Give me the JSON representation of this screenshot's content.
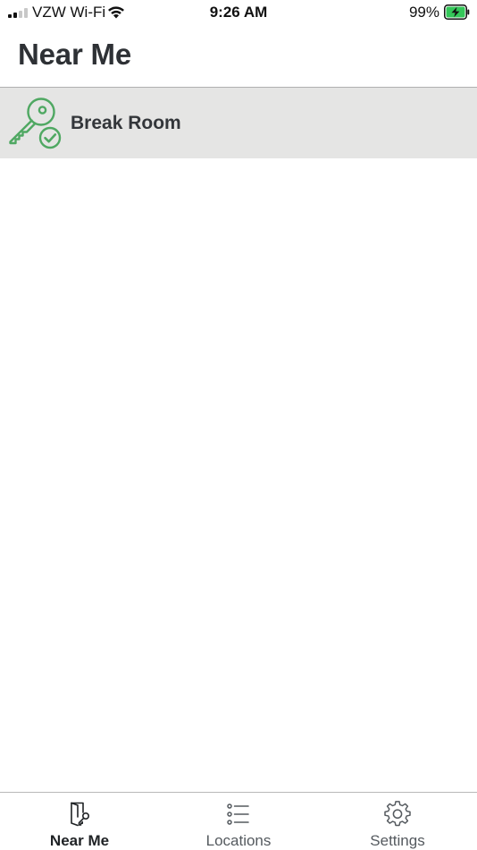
{
  "status_bar": {
    "carrier": "VZW Wi-Fi",
    "time": "9:26 AM",
    "battery_percent": "99%"
  },
  "header": {
    "title": "Near Me"
  },
  "list": {
    "items": [
      {
        "label": "Break Room",
        "icon": "key-check-icon"
      }
    ]
  },
  "tab_bar": {
    "tabs": [
      {
        "label": "Near Me",
        "icon": "door-key-icon",
        "active": true
      },
      {
        "label": "Locations",
        "icon": "list-icon",
        "active": false
      },
      {
        "label": "Settings",
        "icon": "gear-icon",
        "active": false
      }
    ]
  },
  "colors": {
    "accent_green": "#4fa862",
    "row_background": "#e5e5e4",
    "title_text": "#2e3135",
    "battery_green": "#34c759"
  }
}
